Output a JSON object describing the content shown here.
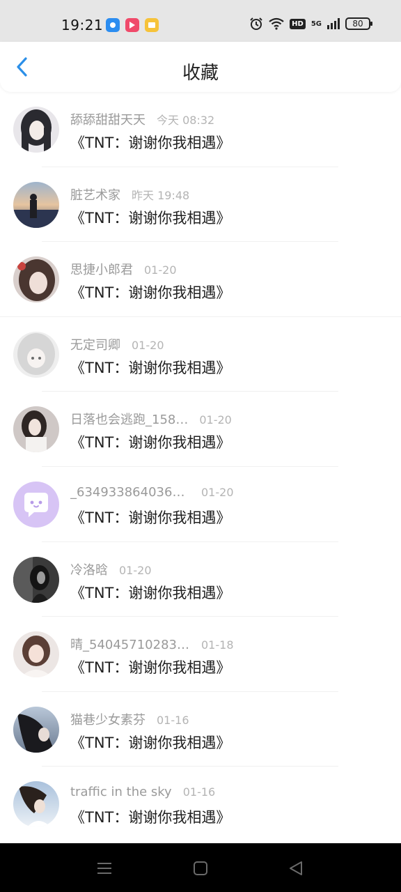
{
  "status_bar": {
    "time": "19:21",
    "network_gen": "5G",
    "hd_label": "HD",
    "battery": "80"
  },
  "header": {
    "title": "收藏",
    "accent_color": "#2b8fe8"
  },
  "favorites": [
    {
      "name": "舔舔甜甜天天",
      "time": "今天 08:32",
      "content": "《TNT：谢谢你我相遇》"
    },
    {
      "name": "脏艺术家",
      "time": "昨天 19:48",
      "content": "《TNT：谢谢你我相遇》"
    },
    {
      "name": "思捷小郎君",
      "time": "01-20",
      "content": "《TNT：谢谢你我相遇》"
    },
    {
      "name": "无定司卿",
      "time": "01-20",
      "content": "《TNT：谢谢你我相遇》"
    },
    {
      "name": "日落也会逃跑_158…",
      "time": "01-20",
      "content": "《TNT：谢谢你我相遇》"
    },
    {
      "name": "_6349338640368…",
      "time": "01-20",
      "content": "《TNT：谢谢你我相遇》"
    },
    {
      "name": "冷洛晗",
      "time": "01-20",
      "content": "《TNT：谢谢你我相遇》"
    },
    {
      "name": "晴_540457102832…",
      "time": "01-18",
      "content": "《TNT：谢谢你我相遇》"
    },
    {
      "name": "猫巷少女素芬",
      "time": "01-16",
      "content": "《TNT：谢谢你我相遇》"
    },
    {
      "name": "traffic in the sky",
      "time": "01-16",
      "content": "《TNT：谢谢你我相遇》"
    }
  ]
}
